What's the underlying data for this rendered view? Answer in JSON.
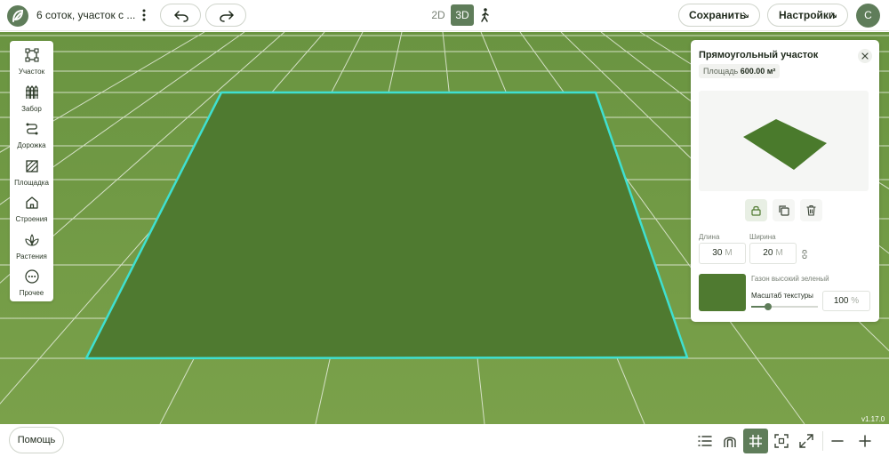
{
  "header": {
    "project_title": "6 соток, участок с ...",
    "view_2d_label": "2D",
    "view_3d_label": "3D",
    "save_label": "Сохранить",
    "settings_label": "Настройки",
    "user_initial": "С",
    "arrow_glyph": "↘"
  },
  "tools": [
    {
      "label": "Участок",
      "icon": "plot-icon"
    },
    {
      "label": "Забор",
      "icon": "fence-icon"
    },
    {
      "label": "Дорожка",
      "icon": "path-icon"
    },
    {
      "label": "Площадка",
      "icon": "pad-icon"
    },
    {
      "label": "Строения",
      "icon": "building-icon"
    },
    {
      "label": "Растения",
      "icon": "plant-icon"
    },
    {
      "label": "Прочее",
      "icon": "more-icon"
    }
  ],
  "panel": {
    "title": "Прямоугольный участок",
    "area_label": "Площадь",
    "area_value": "600.00 м²",
    "length_label": "Длина",
    "length_value": "30",
    "width_label": "Ширина",
    "width_value": "20",
    "unit": "М",
    "texture_name": "Газон высокий зеленый",
    "texture_scale_label": "Масштаб текстуры",
    "texture_scale_value": "100",
    "texture_scale_unit": "%",
    "texture_scale_fraction": 0.25
  },
  "footer": {
    "help_label": "Помощь",
    "version": "v1.17.0"
  },
  "colors": {
    "accent": "#5f7d5a",
    "ground": "#6f9a43",
    "plot": "#4f7a30",
    "plot_outline": "#3fe0d0",
    "grid_line": "#e6eddc"
  }
}
